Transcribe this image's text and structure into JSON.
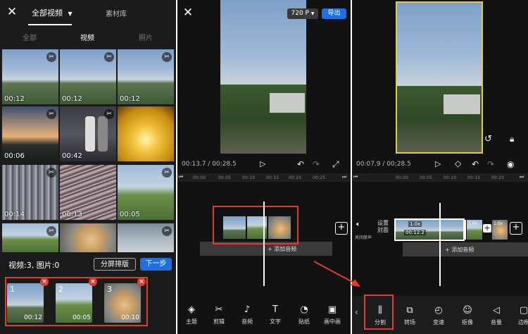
{
  "panel1": {
    "close_icon": "close-icon",
    "album_selector": "全部视频",
    "material_tab": "素材库",
    "filter_tabs": [
      "全部",
      "视频",
      "照片"
    ],
    "grid": [
      {
        "duration": "00:12"
      },
      {
        "duration": "00:12"
      },
      {
        "duration": "00:12"
      },
      {
        "duration": "00:06"
      },
      {
        "duration": "00:42"
      },
      {
        "duration": ""
      },
      {
        "duration": "00:14"
      },
      {
        "duration": "00:13"
      },
      {
        "duration": "00:05"
      },
      {
        "duration": ""
      },
      {
        "duration": ""
      },
      {
        "duration": ""
      }
    ],
    "selection_count": "视频:3, 图片:0",
    "split_layout_button": "分屏排版",
    "next_button": "下一步",
    "selected": [
      {
        "index": "1",
        "duration": "00:12"
      },
      {
        "index": "2",
        "duration": "00:05"
      },
      {
        "index": "3",
        "duration": "00:10"
      }
    ]
  },
  "panel2": {
    "resolution": "720 P",
    "export_button": "导出",
    "time_current": "00:13.7",
    "time_total": "00:28.5",
    "ruler_marks": [
      "00:00",
      "00:05",
      "00:10",
      "00:15",
      "00:20",
      "00:25"
    ],
    "add_audio": "+ 添加音频",
    "toolbar": [
      {
        "label": "主题",
        "icon": "layers-icon"
      },
      {
        "label": "剪辑",
        "icon": "scissors-icon"
      },
      {
        "label": "音频",
        "icon": "music-note-icon"
      },
      {
        "label": "文字",
        "icon": "text-icon"
      },
      {
        "label": "贴纸",
        "icon": "sticker-icon"
      },
      {
        "label": "画中画",
        "icon": "picture-in-picture-icon"
      }
    ]
  },
  "panel3": {
    "time_current": "00:07.9",
    "time_total": "00:28.5",
    "ruler_marks": [
      "00:00",
      "00:05",
      "00:10",
      "00:15",
      "00:20"
    ],
    "cover_label": "设置封面",
    "mute_label": "关闭原声",
    "speed_badge": "1.0x",
    "clip_duration": "00:12.2",
    "add_audio": "+ 添加音频",
    "toolbar": [
      {
        "label": "分割",
        "icon": "split-icon"
      },
      {
        "label": "转场",
        "icon": "transition-icon"
      },
      {
        "label": "变速",
        "icon": "speed-icon"
      },
      {
        "label": "抠像",
        "icon": "person-cutout-icon"
      },
      {
        "label": "音量",
        "icon": "volume-icon"
      },
      {
        "label": "边框",
        "icon": "border-icon"
      }
    ]
  },
  "colors": {
    "accent_blue": "#1f6fe0",
    "highlight_red": "#e33a2c",
    "selected_border": "#e6c84a"
  }
}
